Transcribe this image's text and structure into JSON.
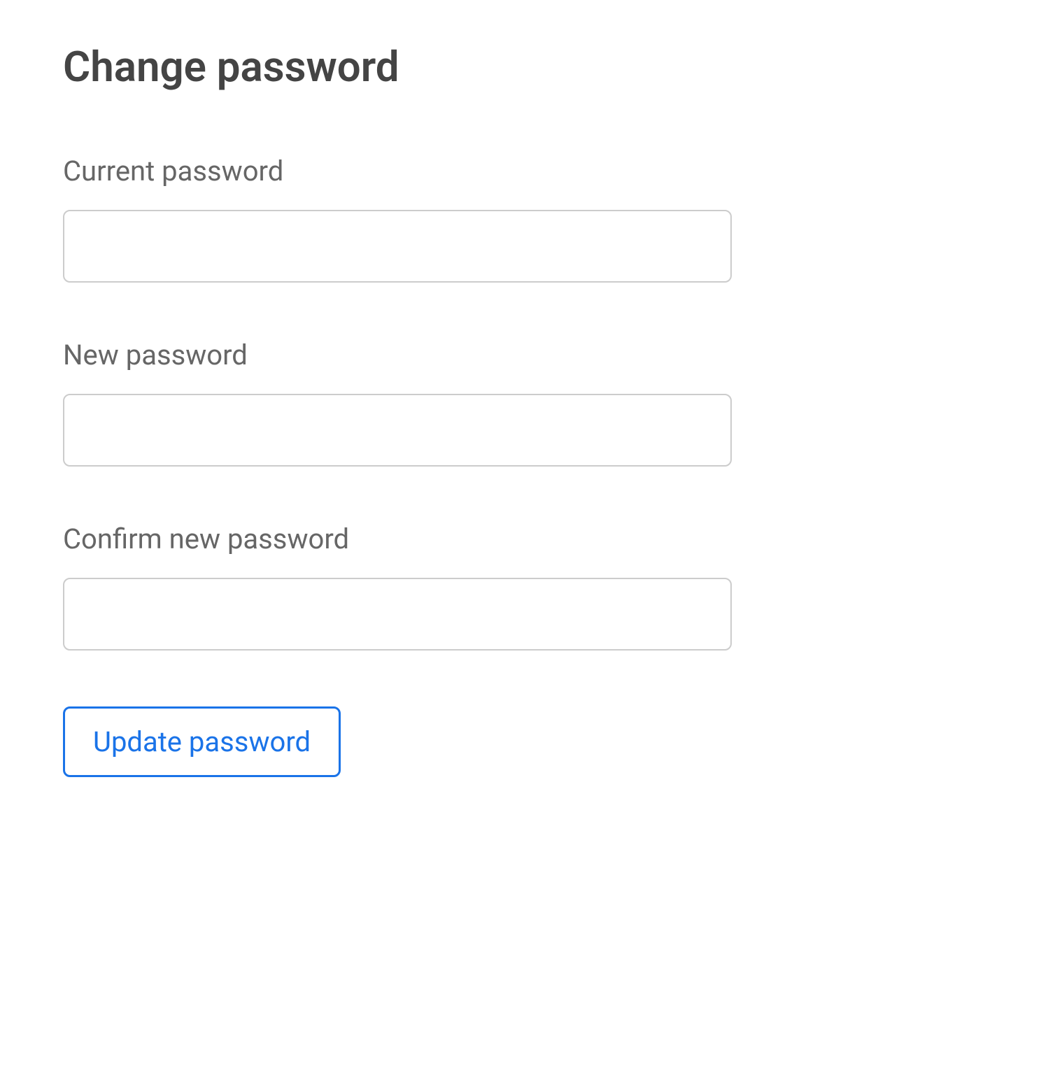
{
  "title": "Change password",
  "fields": {
    "current_password": {
      "label": "Current password",
      "value": ""
    },
    "new_password": {
      "label": "New password",
      "value": ""
    },
    "confirm_password": {
      "label": "Confirm new password",
      "value": ""
    }
  },
  "submit_label": "Update password"
}
